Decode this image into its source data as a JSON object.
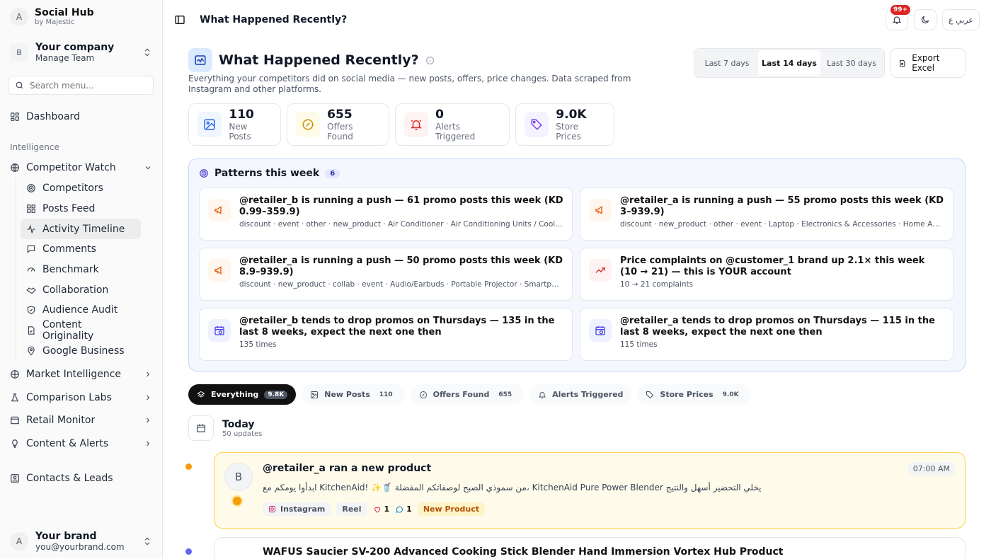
{
  "sidebar": {
    "app_name": "Social Hub",
    "app_by": "by Majestic",
    "app_initial": "A",
    "company_initial": "B",
    "company_name": "Your company",
    "company_sub": "Manage Team",
    "search_placeholder": "Search menu...",
    "dashboard": "Dashboard",
    "section_intelligence": "Intelligence",
    "competitor_watch": "Competitor Watch",
    "sub_items": [
      "Competitors",
      "Posts Feed",
      "Activity Timeline",
      "Comments",
      "Benchmark",
      "Collaboration",
      "Audience Audit",
      "Content Originality",
      "Google Business"
    ],
    "groups": [
      "Market Intelligence",
      "Comparison Labs",
      "Retail Monitor",
      "Content & Alerts"
    ],
    "contacts": "Contacts & Leads",
    "brand_initial": "A",
    "brand_name": "Your brand",
    "brand_email": "you@yourbrand.com"
  },
  "topbar": {
    "title": "What Happened Recently?",
    "notif_badge": "99+",
    "lang": "عربي ع"
  },
  "header": {
    "title": "What Happened Recently?",
    "desc": "Everything your competitors did on social media — new posts, offers, price changes. Data scraped from Instagram and other platforms.",
    "ranges": [
      "Last 7 days",
      "Last 14 days",
      "Last 30 days"
    ],
    "range_selected": "Last 14 days",
    "export": "Export Excel"
  },
  "stats": [
    {
      "num": "110",
      "label": "New Posts"
    },
    {
      "num": "655",
      "label": "Offers Found"
    },
    {
      "num": "0",
      "label": "Alerts Triggered"
    },
    {
      "num": "9.0K",
      "label": "Store Prices"
    }
  ],
  "patterns": {
    "title": "Patterns this week",
    "count": "6",
    "items": [
      {
        "title": "@retailer_b is running a push — 61 promo posts this week (KD 0.99–359.9)",
        "meta": "discount · event · other · new_product · Air Conditioner · Air Conditioning Units / Cooling A..."
      },
      {
        "title": "@retailer_a is running a push — 55 promo posts this week (KD 3–939.9)",
        "meta": "discount · new_product · other · event · Laptop · Electronics & Accessories · Home Applian..."
      },
      {
        "title": "@retailer_a is running a push — 50 promo posts this week (KD 8.9–939.9)",
        "meta": "discount · new_product · collab · event · Audio/Earbuds · Portable Projector · Smartphone"
      },
      {
        "title": "Price complaints on @customer_1 brand up 2.1× this week (10 → 21) — this is YOUR account",
        "meta": "10 → 21 complaints"
      },
      {
        "title": "@retailer_b tends to drop promos on Thursdays — 135 in the last 8 weeks, expect the next one then",
        "meta": "135 times"
      },
      {
        "title": "@retailer_a tends to drop promos on Thursdays — 115 in the last 8 weeks, expect the next one then",
        "meta": "115 times"
      }
    ]
  },
  "filters": [
    {
      "label": "Everything",
      "count": "9.8K"
    },
    {
      "label": "New Posts",
      "count": "110"
    },
    {
      "label": "Offers Found",
      "count": "655"
    },
    {
      "label": "Alerts Triggered",
      "count": ""
    },
    {
      "label": "Store Prices",
      "count": "9.0K"
    }
  ],
  "day": {
    "title": "Today",
    "sub": "50 updates"
  },
  "feed": {
    "avatar": "B",
    "title": "@retailer_a ran a new product",
    "text": "يخلي التحضير أسهل والنتيج KitchenAid Pure Power Blender ،من سموذي الصبح لوصفاتكم المفضلة 🥤✨ !KitchenAid ابدأوا يومكم مع",
    "time": "07:00 AM",
    "platform": "Instagram",
    "format": "Reel",
    "likes": "1",
    "comments": "1",
    "tag": "New Product",
    "next_title": "WAFUS Saucier SV-200 Advanced Cooking Stick Blender Hand Immersion Vortex Hub Product"
  },
  "colors": {
    "accent": "#111111",
    "patterns_bg": "#f5f7ff",
    "highlight": "#fcd34d"
  }
}
